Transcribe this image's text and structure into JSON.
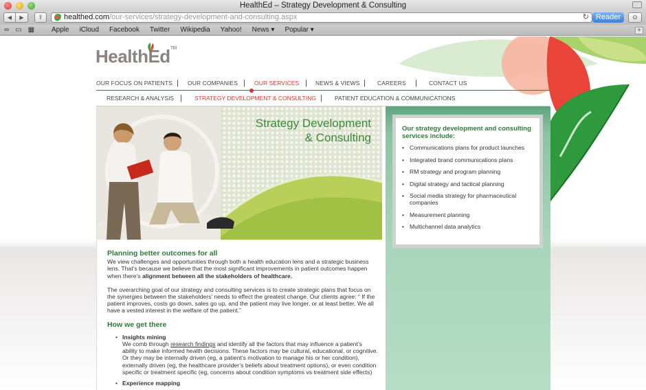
{
  "browser": {
    "window_title": "HealthEd – Strategy Development & Consulting",
    "url_host": "healthed.com",
    "url_path": "/our-services/strategy-development-and-consulting.aspx",
    "reader_label": "Reader",
    "bookmarks": [
      "Apple",
      "iCloud",
      "Facebook",
      "Twitter",
      "Wikipedia",
      "Yahoo!",
      "News ▾",
      "Popular ▾"
    ]
  },
  "site": {
    "logo_health": "Health",
    "logo_ed": "Ed",
    "logo_tm": "TM",
    "main_nav": [
      "OUR FOCUS ON PATIENTS",
      "OUR COMPANIES",
      "OUR SERVICES",
      "NEWS & VIEWS",
      "CAREERS",
      "CONTACT US"
    ],
    "sub_nav": [
      "RESEARCH & ANALYSIS",
      "STRATEGY DEVELOPMENT & CONSULTING",
      "PATIENT EDUCATION & COMMUNICATIONS"
    ],
    "separator": "|"
  },
  "hero": {
    "title_line1": "Strategy Development",
    "title_line2": "& Consulting"
  },
  "sidebar": {
    "heading": "Our strategy development and consulting services include:",
    "items": [
      "Communications plans for product launches",
      "Integrated brand communications plans",
      "RM strategy and program planning",
      "Digital strategy and tactical planning",
      "Social media strategy for pharmaceutical companies",
      "Measurement planning",
      "Multichannel data analytics"
    ]
  },
  "article": {
    "heading1": "Planning better outcomes for all",
    "p1_text": "We view challenges and opportunities through both a health education lens and a strategic business lens. That’s because we believe that the most significant improvements in patient outcomes happen when there’s ",
    "p1_bold": "alignment between all the stakeholders of healthcare.",
    "p2": "The overarching goal of our strategy and consulting services is to create strategic plans that focus on the synergies between the stakeholders’ needs to effect the greatest change. Our clients agree: “ If the patient improves, costs go down, sales go up, and the patient may live longer, or at least better. We all have a vested interest in the welfare of the patient.”",
    "heading2": "How we get there",
    "item1_title": "Insights mining",
    "item1_pre": "We comb through ",
    "item1_link": "research findings",
    "item1_post": " and identify all the factors that may influence a patient’s ability to make informed health decisions. These factors may be cultural, educational, or cognitive. Or they may be internally driven (eg, a patient’s motivation to manage his or her condition), externally driven (eg, the healthcare provider’s beliefs about treatment options), or even condition specific or treatment specific (eg, concerns about condition symptoms vs treatment side effects)",
    "item2_title": "Experience mapping"
  }
}
